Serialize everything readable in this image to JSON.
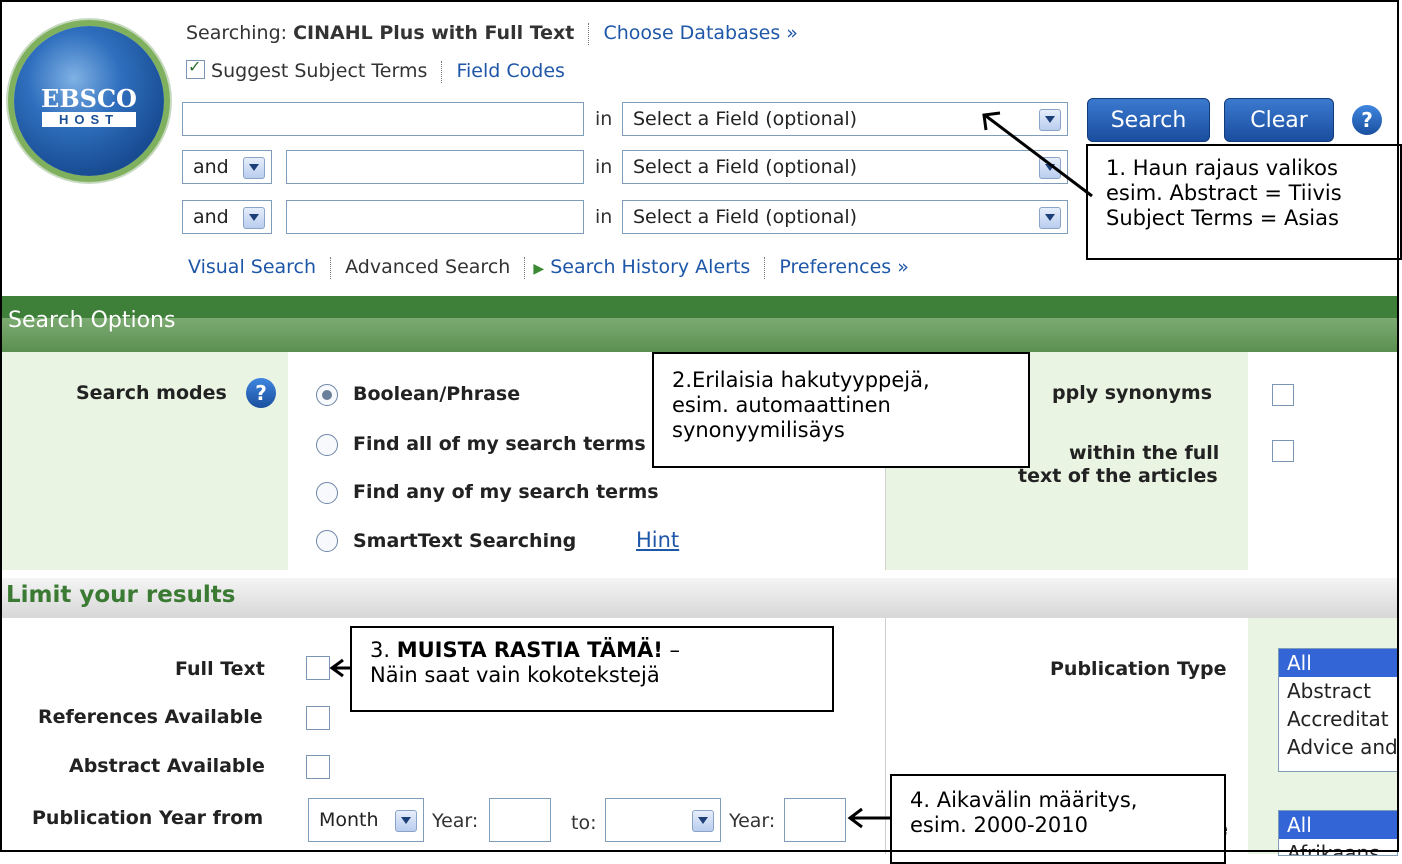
{
  "header": {
    "searching_label": "Searching:",
    "database": "CINAHL Plus with Full Text",
    "choose_databases": "Choose Databases »",
    "suggest_subject_terms": "Suggest Subject Terms",
    "field_codes": "Field Codes",
    "logo_top": "EBSCO",
    "logo_bottom": "HOST"
  },
  "search_rows": [
    {
      "operator": "",
      "in_label": "in",
      "field": "Select a Field (optional)"
    },
    {
      "operator": "and",
      "in_label": "in",
      "field": "Select a Field (optional)"
    },
    {
      "operator": "and",
      "in_label": "in",
      "field": "Select a Field (optional)"
    }
  ],
  "buttons": {
    "search": "Search",
    "clear": "Clear",
    "help": "?"
  },
  "links": {
    "visual_search": "Visual Search",
    "advanced_search": "Advanced Search",
    "search_history_alerts": "Search History Alerts",
    "preferences": "Preferences »"
  },
  "search_options": {
    "title": "Search Options",
    "search_modes_label": "Search modes",
    "modes": [
      "Boolean/Phrase",
      "Find all of my search terms",
      "Find any of my search terms",
      "SmartText Searching"
    ],
    "selected_mode": "Boolean/Phrase",
    "hint": "Hint",
    "apply_synonyms": "pply synonyms",
    "fulltext_line1": "within the full",
    "fulltext_line2": "text of the articles"
  },
  "limits": {
    "title": "Limit your results",
    "full_text": "Full Text",
    "references_available": "References Available",
    "abstract_available": "Abstract Available",
    "publication_year_from": "Publication Year from",
    "month": "Month",
    "year_label": "Year:",
    "to_label": "to:",
    "publication_type": "Publication Type",
    "pubtype_options": [
      "All",
      "Abstract",
      "Accreditat",
      "Advice and"
    ],
    "language_options": [
      "All",
      "Afrikaans"
    ],
    "language_label_fragment": "e"
  },
  "callouts": {
    "c1": [
      "1. Haun rajaus valikos",
      "esim. Abstract = Tiivis",
      "Subject Terms = Asias"
    ],
    "c2": [
      "2.Erilaisia hakutyyppejä,",
      "esim. automaattinen",
      "synonyymilisäys"
    ],
    "c3_bold": "MUISTA RASTIA TÄMÄ!",
    "c3_prefix": "3.",
    "c3_suffix": " –",
    "c3_line2": "Näin saat vain kokotekstejä",
    "c4": [
      "4. Aikavälin määritys,",
      "esim. 2000-2010"
    ]
  }
}
